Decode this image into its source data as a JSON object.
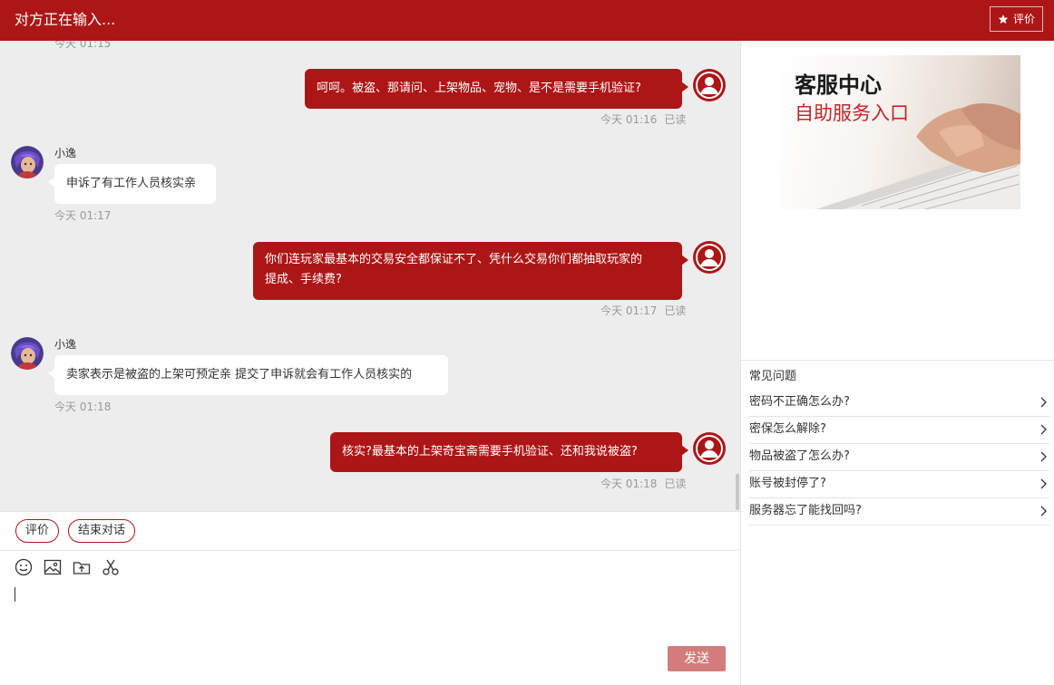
{
  "header": {
    "title": "对方正在输入...",
    "rate_label": "评价"
  },
  "messages": {
    "partial_time": "今天 01:15",
    "m1": {
      "text": "呵呵。被盗、那请问、上架物品、宠物、是不是需要手机验证?",
      "time": "今天 01:16",
      "status": "已读"
    },
    "m2": {
      "name": "小逸",
      "text": "申诉了有工作人员核实亲",
      "time": "今天 01:17"
    },
    "m3": {
      "line1": "你们连玩家最基本的交易安全都保证不了、凭什么交易你们都抽取玩家的",
      "line2": "提成、手续费?",
      "time": "今天 01:17",
      "status": "已读"
    },
    "m4": {
      "name": "小逸",
      "text": "卖家表示是被盗的上架可预定亲 提交了申诉就会有工作人员核实的",
      "time": "今天 01:18"
    },
    "m5": {
      "text": "核实?最基本的上架奇宝斋需要手机验证、还和我说被盗?",
      "time": "今天 01:18",
      "status": "已读"
    }
  },
  "actions": {
    "rate": "评价",
    "end": "结束对话"
  },
  "composer": {
    "send": "发送"
  },
  "sidebar": {
    "banner_title": "客服中心",
    "banner_subtitle": "自助服务入口",
    "faq_title": "常见问题",
    "faq": [
      "密码不正确怎么办?",
      "密保怎么解除?",
      "物品被盗了怎么办?",
      "账号被封停了?",
      "服务器忘了能找回吗?"
    ]
  },
  "colors": {
    "brand": "#ad1617",
    "chat_bg": "#ededee",
    "send_disabled": "#d27c7c"
  }
}
